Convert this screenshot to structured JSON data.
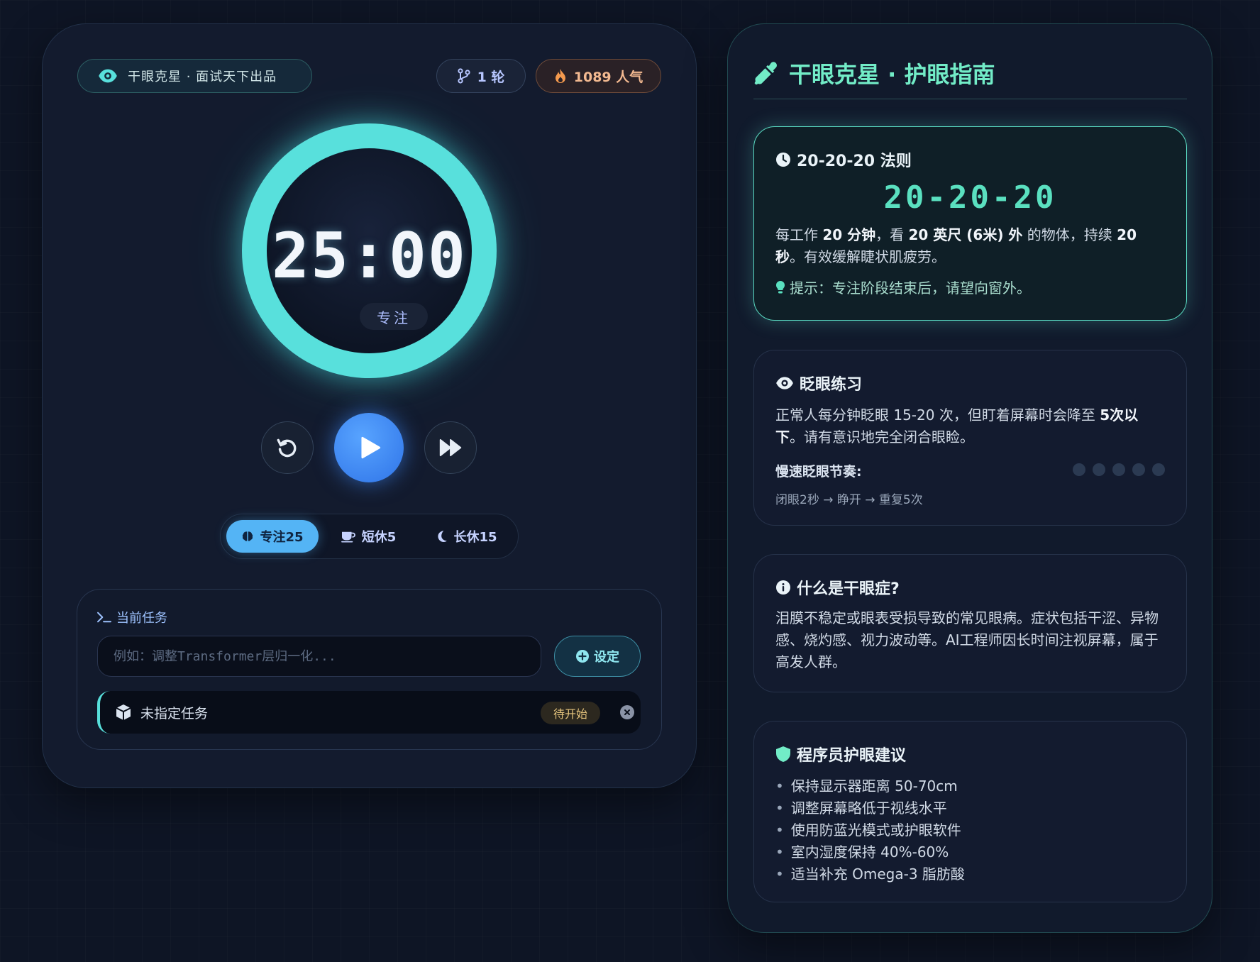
{
  "brand": {
    "label": "干眼克星 · 面试天下出品",
    "icon": "eye-icon",
    "accent": "#58e0dc"
  },
  "stats": {
    "rounds": "1 轮",
    "popularity": "1089 人气",
    "rounds_icon": "branch-icon",
    "popularity_icon": "flame-icon"
  },
  "timer": {
    "display": "25:00",
    "mode_label": "专注"
  },
  "controls": {
    "reset": "reset-icon",
    "play": "play-icon",
    "skip": "fast-forward-icon",
    "play_color": "#3f8cf5"
  },
  "modes": [
    {
      "label": "专注25",
      "icon": "brain-icon",
      "active": true
    },
    {
      "label": "短休5",
      "icon": "coffee-icon",
      "active": false
    },
    {
      "label": "长休15",
      "icon": "moon-icon",
      "active": false
    }
  ],
  "task": {
    "section_title": "当前任务",
    "input_placeholder": "例如：调整Transformer层归一化...",
    "input_value": "",
    "set_button": "设定",
    "current_name": "未指定任务",
    "status": "待开始"
  },
  "guide": {
    "title": "干眼克星 · 护眼指南",
    "rule_card": {
      "title": "20-20-20 法则",
      "big_text": "20-20-20",
      "desc_1": "每工作 ",
      "desc_b1": "20 分钟",
      "desc_2": "，看 ",
      "desc_b2": "20 英尺 (6米) 外",
      "desc_3": " 的物体，持续 ",
      "desc_b3": "20 秒",
      "desc_4": "。有效缓解睫状肌疲劳。",
      "hint": "提示：专注阶段结束后，请望向窗外。"
    },
    "blink_card": {
      "title": "眨眼练习",
      "desc_1": "正常人每分钟眨眼 15-20 次，但盯着屏幕时会降至 ",
      "desc_b1": "5次以下",
      "desc_2": "。请有意识地完全闭合眼睑。",
      "rhythm_label": "慢速眨眼节奏:",
      "rhythm_sub": "闭眼2秒 → 睁开 → 重复5次",
      "dot_count": 5
    },
    "dry_eye_card": {
      "title": "什么是干眼症?",
      "desc": "泪膜不稳定或眼表受损导致的常见眼病。症状包括干涩、异物感、烧灼感、视力波动等。AI工程师因长时间注视屏幕，属于高发人群。"
    },
    "advice_card": {
      "title": "程序员护眼建议",
      "items": [
        "保持显示器距离 50-70cm",
        "调整屏幕略低于视线水平",
        "使用防蓝光模式或护眼软件",
        "室内湿度保持 40%-60%",
        "适当补充 Omega-3 脂肪酸"
      ]
    }
  }
}
